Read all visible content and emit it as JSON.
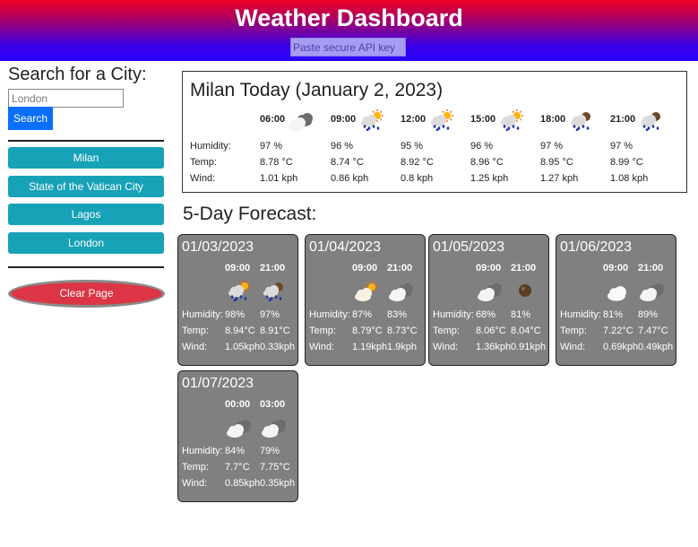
{
  "header": {
    "title": "Weather Dashboard",
    "api_placeholder": "Paste secure API key"
  },
  "sidebar": {
    "heading": "Search for a City:",
    "search_placeholder": "London",
    "search_label": "Search",
    "history": [
      "Milan",
      "State of the Vatican City",
      "Lagos",
      "London"
    ],
    "clear_label": "Clear Page"
  },
  "today": {
    "title": "Milan Today (January 2, 2023)",
    "labels": {
      "humidity": "Humidity:",
      "temp": "Temp:",
      "wind": "Wind:"
    },
    "slots": [
      {
        "time": "06:00",
        "icon": "cloudy-icon",
        "humidity": "97 %",
        "temp": "8.78 °C",
        "wind": "1.01 kph"
      },
      {
        "time": "09:00",
        "icon": "sun-rain-icon",
        "humidity": "96 %",
        "temp": "8.74 °C",
        "wind": "0.86 kph"
      },
      {
        "time": "12:00",
        "icon": "sun-rain-icon",
        "humidity": "95 %",
        "temp": "8.92 °C",
        "wind": "0.8 kph"
      },
      {
        "time": "15:00",
        "icon": "sun-rain-icon",
        "humidity": "96 %",
        "temp": "8.96 °C",
        "wind": "1.25 kph"
      },
      {
        "time": "18:00",
        "icon": "night-rain-icon",
        "humidity": "97 %",
        "temp": "8.95 °C",
        "wind": "1.27 kph"
      },
      {
        "time": "21:00",
        "icon": "night-rain-icon",
        "humidity": "97 %",
        "temp": "8.99 °C",
        "wind": "1.08 kph"
      }
    ]
  },
  "forecast": {
    "title": "5-Day Forecast:",
    "labels": {
      "humidity": "Humidity:",
      "temp": "Temp:",
      "wind": "Wind:"
    },
    "days": [
      {
        "date": "01/03/2023",
        "slots": [
          {
            "time": "09:00",
            "icon": "sun-rain-icon",
            "humidity": "98%",
            "temp": "8.94°C",
            "wind": "1.05kph"
          },
          {
            "time": "21:00",
            "icon": "night-rain-icon",
            "humidity": "97%",
            "temp": "8.91°C",
            "wind": "0.33kph"
          }
        ]
      },
      {
        "date": "01/04/2023",
        "slots": [
          {
            "time": "09:00",
            "icon": "partly-sunny-icon",
            "humidity": "87%",
            "temp": "8.79°C",
            "wind": "1.19kph"
          },
          {
            "time": "21:00",
            "icon": "cloudy-icon",
            "humidity": "83%",
            "temp": "8.73°C",
            "wind": "1.9kph"
          }
        ]
      },
      {
        "date": "01/05/2023",
        "slots": [
          {
            "time": "09:00",
            "icon": "cloudy-icon",
            "humidity": "68%",
            "temp": "8.06°C",
            "wind": "1.36kph"
          },
          {
            "time": "21:00",
            "icon": "moon-icon",
            "humidity": "81%",
            "temp": "8.04°C",
            "wind": "0.91kph"
          }
        ]
      },
      {
        "date": "01/06/2023",
        "slots": [
          {
            "time": "09:00",
            "icon": "white-cloud-icon",
            "humidity": "81%",
            "temp": "7.22°C",
            "wind": "0.69kph"
          },
          {
            "time": "21:00",
            "icon": "cloudy-icon",
            "humidity": "89%",
            "temp": "7.47°C",
            "wind": "0.49kph"
          }
        ]
      },
      {
        "date": "01/07/2023",
        "slots": [
          {
            "time": "00:00",
            "icon": "cloudy-icon",
            "humidity": "84%",
            "temp": "7.7°C",
            "wind": "0.85kph"
          },
          {
            "time": "03:00",
            "icon": "cloudy-icon",
            "humidity": "79%",
            "temp": "7.75°C",
            "wind": "0.35kph"
          }
        ]
      }
    ]
  }
}
